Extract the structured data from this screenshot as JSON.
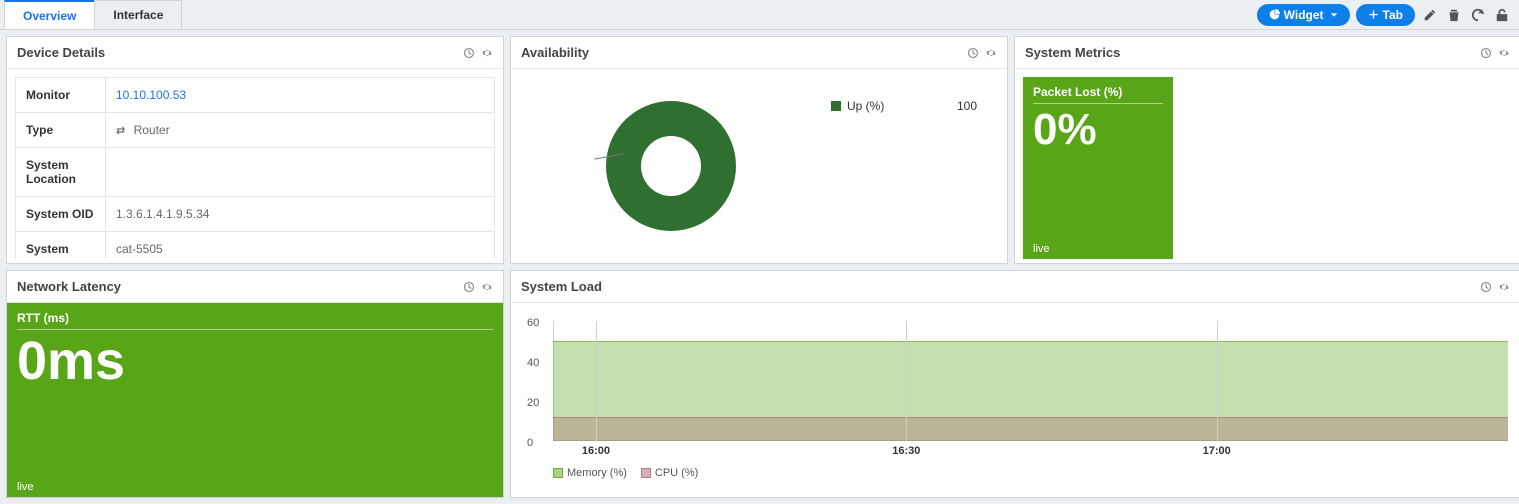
{
  "tabs": [
    {
      "label": "Overview",
      "active": true
    },
    {
      "label": "Interface",
      "active": false
    }
  ],
  "toolbar": {
    "widget_btn": "Widget",
    "tab_btn": "Tab"
  },
  "panels": {
    "device_details": {
      "title": "Device Details",
      "rows": {
        "monitor": {
          "label": "Monitor",
          "value": "10.10.100.53"
        },
        "type": {
          "label": "Type",
          "value": "Router"
        },
        "system_location": {
          "label": "System Location",
          "value": ""
        },
        "system_oid": {
          "label": "System OID",
          "value": "1.3.6.1.4.1.9.5.34"
        },
        "system_name": {
          "label": "System",
          "value": "cat-5505"
        }
      }
    },
    "availability": {
      "title": "Availability",
      "legend": {
        "up_label": "Up (%)",
        "up_value": "100"
      }
    },
    "system_metrics": {
      "title": "System Metrics",
      "card": {
        "title": "Packet Lost (%)",
        "value": "0%",
        "footer": "live"
      }
    },
    "network_latency": {
      "title": "Network Latency",
      "card": {
        "title": "RTT (ms)",
        "value": "0ms",
        "footer": "live"
      }
    },
    "system_load": {
      "title": "System Load",
      "legend": {
        "mem": "Memory (%)",
        "cpu": "CPU (%)"
      }
    }
  },
  "chart_data": [
    {
      "type": "pie",
      "title": "Availability",
      "series": [
        {
          "name": "Up (%)",
          "value": 100
        }
      ]
    },
    {
      "type": "area",
      "title": "System Load",
      "ylabel": "",
      "ylim": [
        0,
        60
      ],
      "y_ticks": [
        0,
        20,
        40,
        60
      ],
      "x_ticks": [
        "16:00",
        "16:30",
        "17:00"
      ],
      "series": [
        {
          "name": "Memory (%)",
          "values": [
            50,
            50,
            50
          ]
        },
        {
          "name": "CPU (%)",
          "values": [
            12,
            12,
            12
          ]
        }
      ]
    }
  ]
}
